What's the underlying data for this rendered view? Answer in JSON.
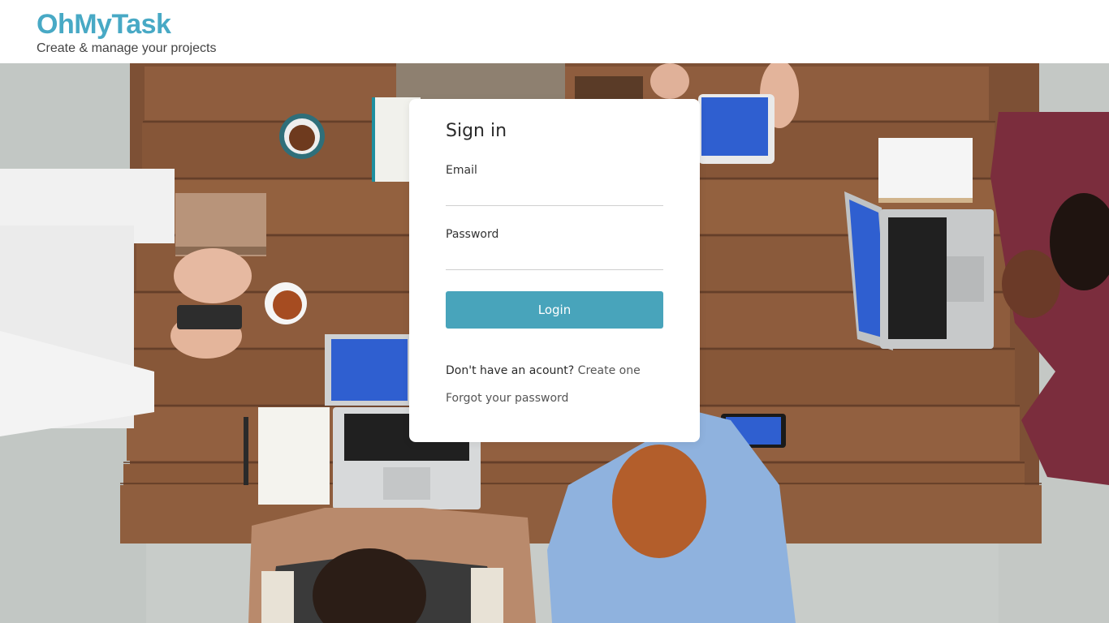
{
  "header": {
    "title": "OhMyTask",
    "tagline": "Create & manage your projects"
  },
  "login": {
    "title": "Sign in",
    "email_label": "Email",
    "email_value": "",
    "password_label": "Password",
    "password_value": "",
    "login_button": "Login",
    "signup_prompt": "Don't have an acount?",
    "signup_link": "Create one",
    "forgot_link": "Forgot your password"
  },
  "colors": {
    "brand": "#48a9c5",
    "button": "#48a4bb",
    "table_wood": "#8a5a3c",
    "laptop_screen": "#2f5fd0"
  }
}
